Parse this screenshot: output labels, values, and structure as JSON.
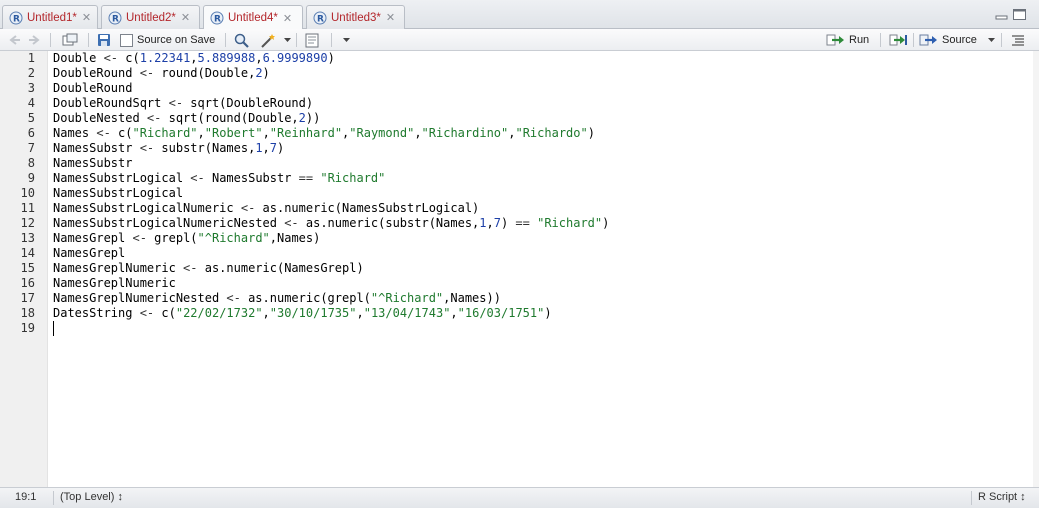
{
  "tabs": [
    {
      "label": "Untitled1*",
      "active": false
    },
    {
      "label": "Untitled2*",
      "active": false
    },
    {
      "label": "Untitled4*",
      "active": true
    },
    {
      "label": "Untitled3*",
      "active": false
    }
  ],
  "toolbar": {
    "source_on_save_label": "Source on Save",
    "run_label": "Run",
    "source_label": "Source"
  },
  "code": {
    "lines": [
      [
        {
          "t": "Double ",
          "c": "id"
        },
        {
          "t": "<- ",
          "c": "op"
        },
        {
          "t": "c(",
          "c": "id"
        },
        {
          "t": "1.22341",
          "c": "num"
        },
        {
          "t": ",",
          "c": "id"
        },
        {
          "t": "5.889988",
          "c": "num"
        },
        {
          "t": ",",
          "c": "id"
        },
        {
          "t": "6.9999890",
          "c": "num"
        },
        {
          "t": ")",
          "c": "id"
        }
      ],
      [
        {
          "t": "DoubleRound ",
          "c": "id"
        },
        {
          "t": "<- ",
          "c": "op"
        },
        {
          "t": "round(Double,",
          "c": "id"
        },
        {
          "t": "2",
          "c": "num"
        },
        {
          "t": ")",
          "c": "id"
        }
      ],
      [
        {
          "t": "DoubleRound",
          "c": "id"
        }
      ],
      [
        {
          "t": "DoubleRoundSqrt ",
          "c": "id"
        },
        {
          "t": "<- ",
          "c": "op"
        },
        {
          "t": "sqrt(DoubleRound)",
          "c": "id"
        }
      ],
      [
        {
          "t": "DoubleNested ",
          "c": "id"
        },
        {
          "t": "<- ",
          "c": "op"
        },
        {
          "t": "sqrt(round(Double,",
          "c": "id"
        },
        {
          "t": "2",
          "c": "num"
        },
        {
          "t": "))",
          "c": "id"
        }
      ],
      [
        {
          "t": "Names ",
          "c": "id"
        },
        {
          "t": "<- ",
          "c": "op"
        },
        {
          "t": "c(",
          "c": "id"
        },
        {
          "t": "\"Richard\"",
          "c": "str"
        },
        {
          "t": ",",
          "c": "id"
        },
        {
          "t": "\"Robert\"",
          "c": "str"
        },
        {
          "t": ",",
          "c": "id"
        },
        {
          "t": "\"Reinhard\"",
          "c": "str"
        },
        {
          "t": ",",
          "c": "id"
        },
        {
          "t": "\"Raymond\"",
          "c": "str"
        },
        {
          "t": ",",
          "c": "id"
        },
        {
          "t": "\"Richardino\"",
          "c": "str"
        },
        {
          "t": ",",
          "c": "id"
        },
        {
          "t": "\"Richardo\"",
          "c": "str"
        },
        {
          "t": ")",
          "c": "id"
        }
      ],
      [
        {
          "t": "NamesSubstr ",
          "c": "id"
        },
        {
          "t": "<- ",
          "c": "op"
        },
        {
          "t": "substr(Names,",
          "c": "id"
        },
        {
          "t": "1",
          "c": "num"
        },
        {
          "t": ",",
          "c": "id"
        },
        {
          "t": "7",
          "c": "num"
        },
        {
          "t": ")",
          "c": "id"
        }
      ],
      [
        {
          "t": "NamesSubstr",
          "c": "id"
        }
      ],
      [
        {
          "t": "NamesSubstrLogical ",
          "c": "id"
        },
        {
          "t": "<- ",
          "c": "op"
        },
        {
          "t": "NamesSubstr ",
          "c": "id"
        },
        {
          "t": "== ",
          "c": "op"
        },
        {
          "t": "\"Richard\"",
          "c": "str"
        }
      ],
      [
        {
          "t": "NamesSubstrLogical",
          "c": "id"
        }
      ],
      [
        {
          "t": "NamesSubstrLogicalNumeric ",
          "c": "id"
        },
        {
          "t": "<- ",
          "c": "op"
        },
        {
          "t": "as.numeric(NamesSubstrLogical)",
          "c": "id"
        }
      ],
      [
        {
          "t": "NamesSubstrLogicalNumericNested ",
          "c": "id"
        },
        {
          "t": "<- ",
          "c": "op"
        },
        {
          "t": "as.numeric(substr(Names,",
          "c": "id"
        },
        {
          "t": "1",
          "c": "num"
        },
        {
          "t": ",",
          "c": "id"
        },
        {
          "t": "7",
          "c": "num"
        },
        {
          "t": ") ",
          "c": "id"
        },
        {
          "t": "== ",
          "c": "op"
        },
        {
          "t": "\"Richard\"",
          "c": "str"
        },
        {
          "t": ")",
          "c": "id"
        }
      ],
      [
        {
          "t": "NamesGrepl ",
          "c": "id"
        },
        {
          "t": "<- ",
          "c": "op"
        },
        {
          "t": "grepl(",
          "c": "id"
        },
        {
          "t": "\"^Richard\"",
          "c": "str"
        },
        {
          "t": ",Names)",
          "c": "id"
        }
      ],
      [
        {
          "t": "NamesGrepl",
          "c": "id"
        }
      ],
      [
        {
          "t": "NamesGreplNumeric ",
          "c": "id"
        },
        {
          "t": "<- ",
          "c": "op"
        },
        {
          "t": "as.numeric(NamesGrepl)",
          "c": "id"
        }
      ],
      [
        {
          "t": "NamesGreplNumeric",
          "c": "id"
        }
      ],
      [
        {
          "t": "NamesGreplNumericNested ",
          "c": "id"
        },
        {
          "t": "<- ",
          "c": "op"
        },
        {
          "t": "as.numeric(grepl(",
          "c": "id"
        },
        {
          "t": "\"^Richard\"",
          "c": "str"
        },
        {
          "t": ",Names))",
          "c": "id"
        }
      ],
      [
        {
          "t": "DatesString ",
          "c": "id"
        },
        {
          "t": "<- ",
          "c": "op"
        },
        {
          "t": "c(",
          "c": "id"
        },
        {
          "t": "\"22/02/1732\"",
          "c": "str"
        },
        {
          "t": ",",
          "c": "id"
        },
        {
          "t": "\"30/10/1735\"",
          "c": "str"
        },
        {
          "t": ",",
          "c": "id"
        },
        {
          "t": "\"13/04/1743\"",
          "c": "str"
        },
        {
          "t": ",",
          "c": "id"
        },
        {
          "t": "\"16/03/1751\"",
          "c": "str"
        },
        {
          "t": ")",
          "c": "id"
        }
      ],
      []
    ]
  },
  "status": {
    "cursor_position": "19:1",
    "scope": "(Top Level) ↕",
    "file_type": "R Script ↕"
  },
  "colors": {
    "tab_label": "#b3262b",
    "number": "#1c3fa7",
    "string": "#1f7a2e",
    "gutter": "#f0f0f0"
  }
}
